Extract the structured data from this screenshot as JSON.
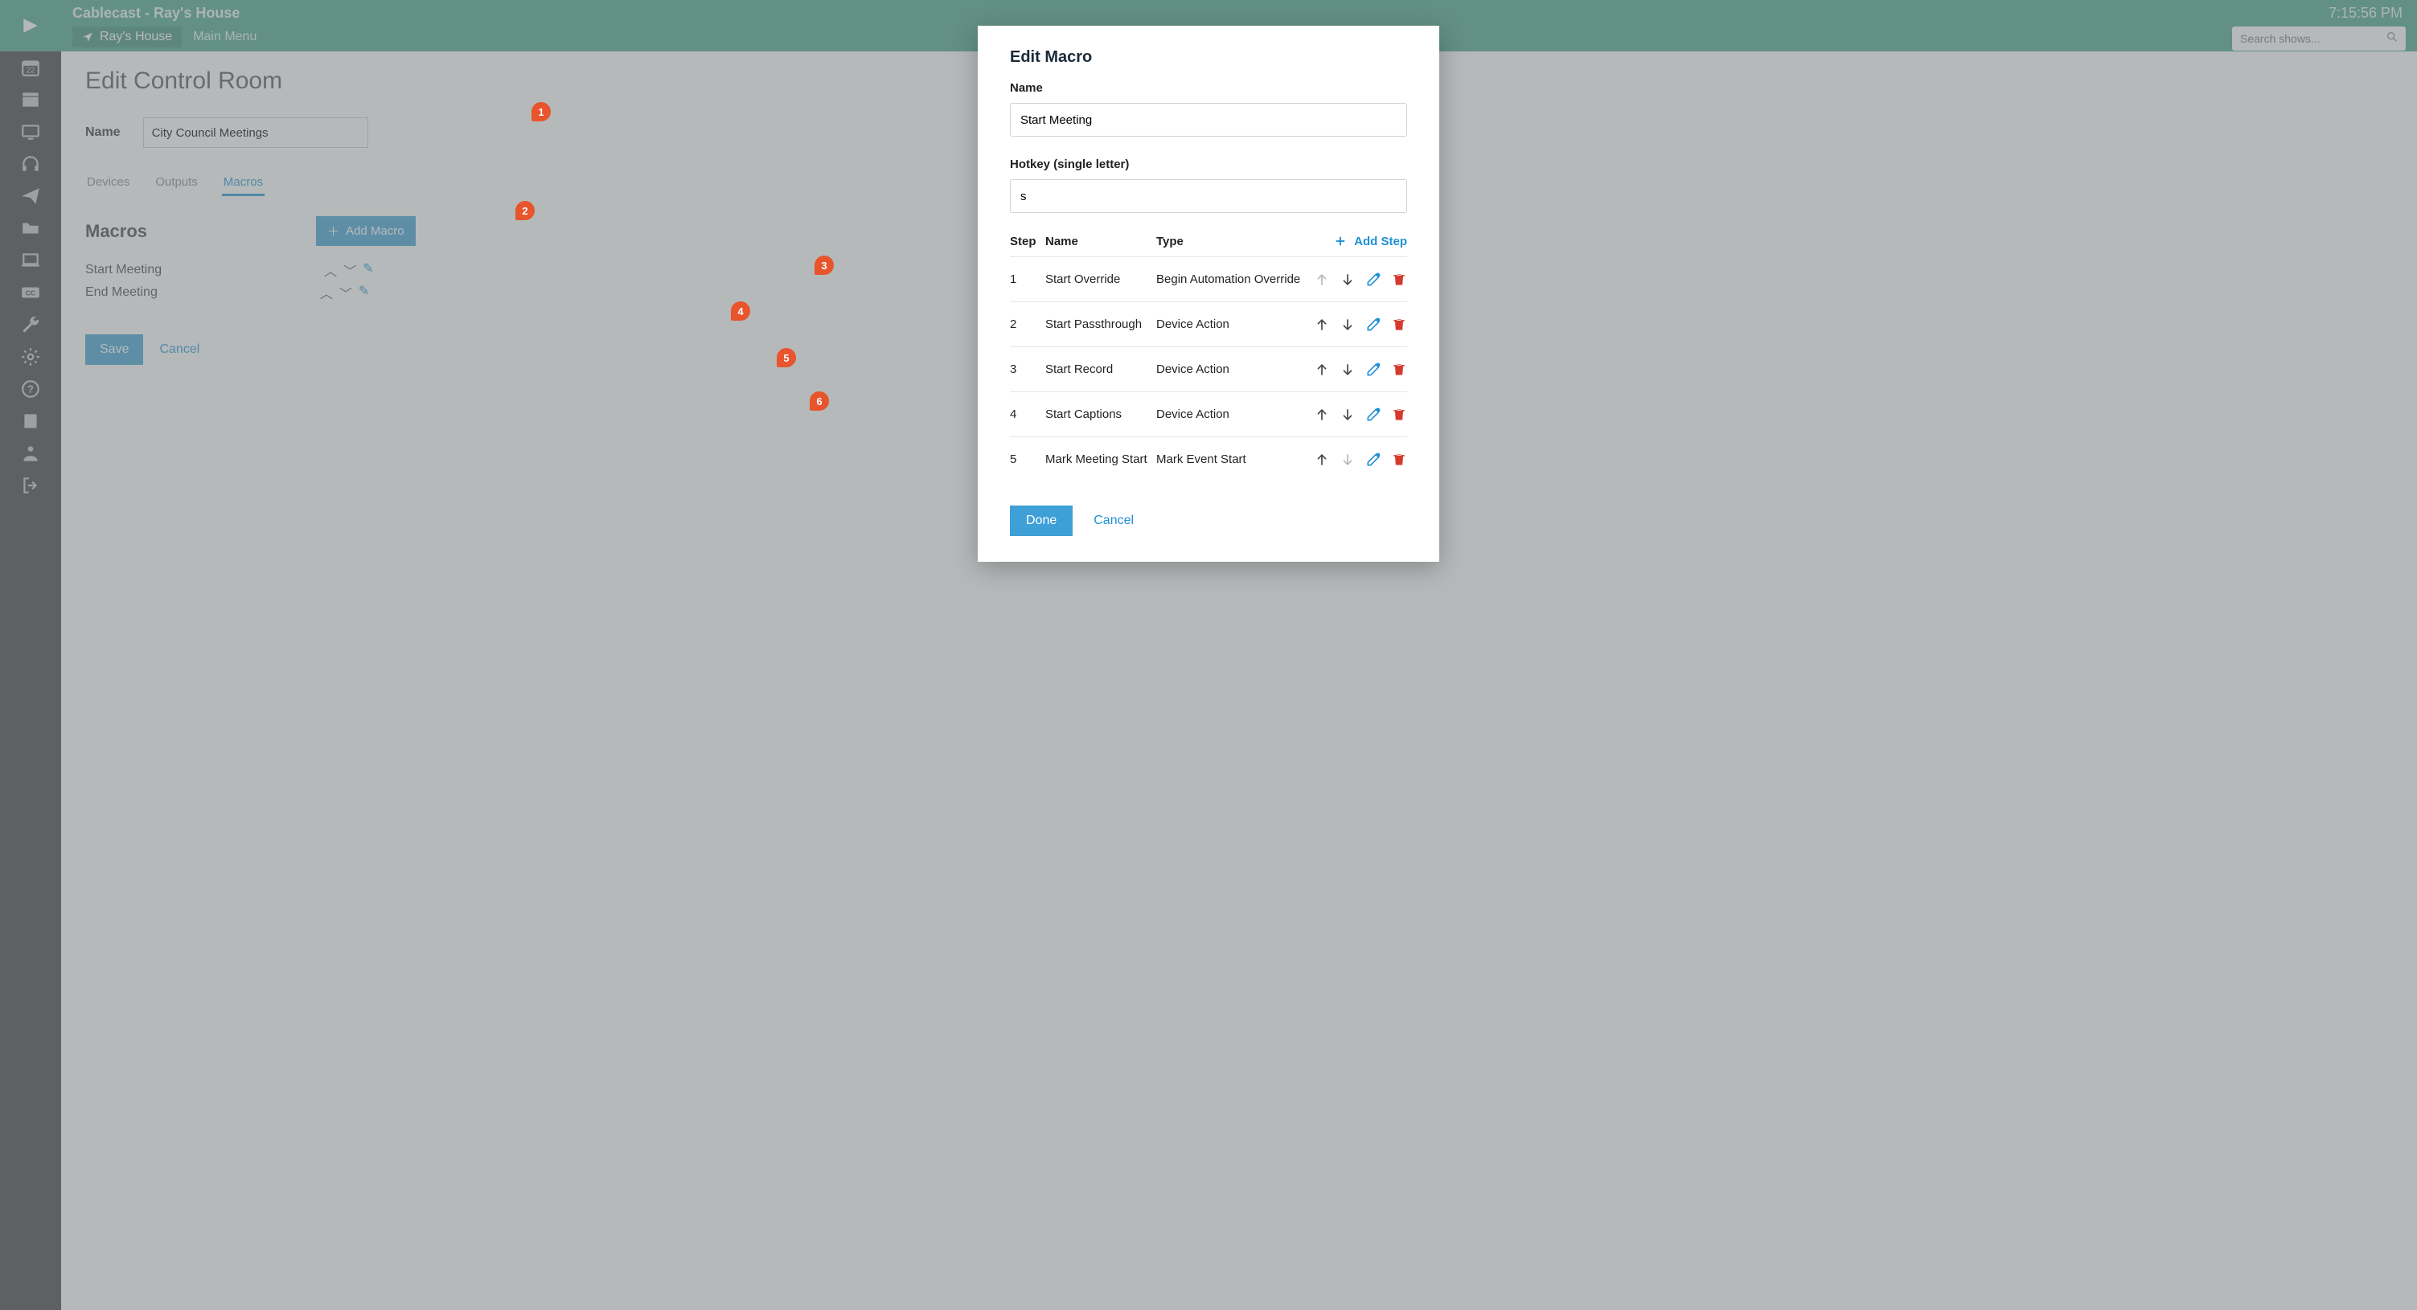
{
  "header": {
    "title": "Cablecast - Ray's House",
    "location": "Ray's House",
    "menu_label": "Main Menu",
    "clock": "7:15:56 PM",
    "search_placeholder": "Search shows..."
  },
  "page": {
    "heading": "Edit Control Room",
    "name_label": "Name",
    "name_value": "City Council Meetings",
    "tabs": {
      "devices": "Devices",
      "outputs": "Outputs",
      "macros": "Macros"
    },
    "macros_heading": "Macros",
    "add_macro_label": "Add Macro",
    "macros_list": [
      {
        "label": "Start Meeting"
      },
      {
        "label": "End Meeting"
      }
    ],
    "save_label": "Save",
    "cancel_label": "Cancel"
  },
  "modal": {
    "heading": "Edit Macro",
    "name_label": "Name",
    "name_value": "Start Meeting",
    "hotkey_label": "Hotkey (single letter)",
    "hotkey_value": "s",
    "cols": {
      "step": "Step",
      "name": "Name",
      "type": "Type"
    },
    "add_step_label": "Add Step",
    "steps": [
      {
        "num": "1",
        "name": "Start Override",
        "type": "Begin Automation Override",
        "up_disabled": true,
        "down_disabled": false
      },
      {
        "num": "2",
        "name": "Start Passthrough",
        "type": "Device Action",
        "up_disabled": false,
        "down_disabled": false
      },
      {
        "num": "3",
        "name": "Start Record",
        "type": "Device Action",
        "up_disabled": false,
        "down_disabled": false
      },
      {
        "num": "4",
        "name": "Start Captions",
        "type": "Device Action",
        "up_disabled": false,
        "down_disabled": false
      },
      {
        "num": "5",
        "name": "Mark Meeting Start",
        "type": "Mark Event Start",
        "up_disabled": false,
        "down_disabled": true
      }
    ],
    "done_label": "Done",
    "cancel_label": "Cancel"
  },
  "annotations": [
    "1",
    "2",
    "3",
    "4",
    "5",
    "6"
  ]
}
